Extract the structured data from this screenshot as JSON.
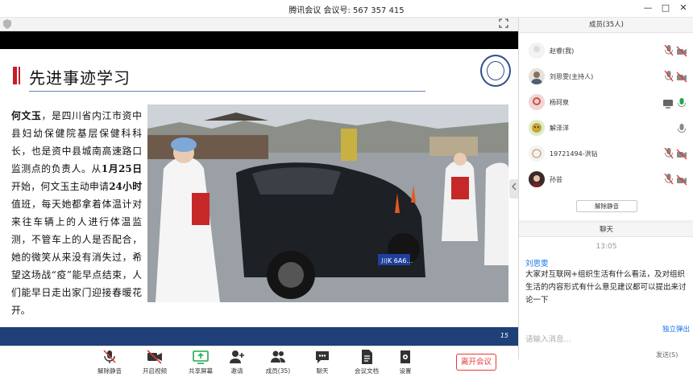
{
  "window": {
    "title": "腾讯会议 会议号: 567 357 415",
    "minimize": "—",
    "maximize": "□",
    "close": "✕"
  },
  "slide": {
    "title": "先进事迹学习",
    "body_name": "何文玉",
    "body_part1": "，是四川省内江市资中县妇幼保健院基层保健科科长，也是资中县城南高速路口监测点的负责人。从",
    "body_date": "1月25日",
    "body_part2": "开始，何文玉主动申请",
    "body_hours": "24小时",
    "body_part3": "值班，每天她都拿着体温计对来往车辆上的人进行体温监测，不管车上的人是否配合，她的微笑从来没有消失过，希望这场战“疫”能早点结束，人们能早日走出家门迎接春暖花开。",
    "page_number": "15",
    "plate_text": "川K 6A6…"
  },
  "toolbar": {
    "mute_label": "解除静音",
    "video_label": "开启视频",
    "share_label": "共享屏幕",
    "invite_label": "邀请",
    "members_label": "成员(35)",
    "chat_label": "聊天",
    "docs_label": "会议文档",
    "settings_label": "设置",
    "leave_label": "离开会议"
  },
  "members": {
    "header": "成员(35人)",
    "list": [
      {
        "name": "赵睿(我)"
      },
      {
        "name": "刘思雯(主持人)"
      },
      {
        "name": "杨珂泉"
      },
      {
        "name": "解泽洋"
      },
      {
        "name": "19721494-洪钻"
      },
      {
        "name": "孙芸"
      }
    ],
    "unmute_all": "解除静音"
  },
  "chat": {
    "header": "聊天",
    "time": "13:05",
    "sender": "刘思雯",
    "message": "大家对互联网+组织生活有什么看法，及对组织生活的内容形式有什么意见建议都可以提出来讨论一下",
    "private_chat": "独立弹出",
    "input_placeholder": "请输入消息...",
    "send_label": "发送(S)"
  },
  "colors": {
    "accent_red": "#c0202a",
    "footer_blue": "#1f3f78",
    "link_blue": "#1a73e8",
    "muted_red": "#e53935",
    "active_green": "#20a84c"
  }
}
